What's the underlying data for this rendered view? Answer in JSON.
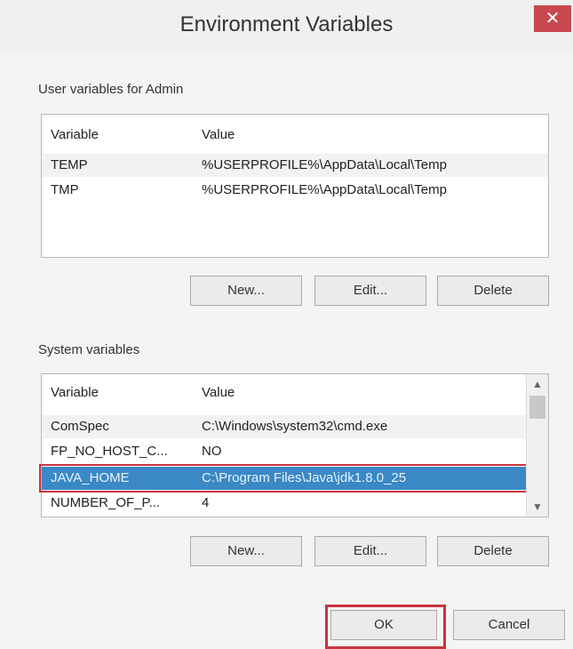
{
  "window": {
    "title": "Environment Variables",
    "close_icon": "close-icon"
  },
  "user_section": {
    "label": "User variables for Admin",
    "columns": [
      "Variable",
      "Value"
    ],
    "rows": [
      {
        "variable": "TEMP",
        "value": "%USERPROFILE%\\AppData\\Local\\Temp"
      },
      {
        "variable": "TMP",
        "value": "%USERPROFILE%\\AppData\\Local\\Temp"
      }
    ],
    "buttons": {
      "new": "New...",
      "edit": "Edit...",
      "delete": "Delete"
    }
  },
  "system_section": {
    "label": "System variables",
    "columns": [
      "Variable",
      "Value"
    ],
    "rows": [
      {
        "variable": "ComSpec",
        "value": "C:\\Windows\\system32\\cmd.exe"
      },
      {
        "variable": "FP_NO_HOST_C...",
        "value": "NO"
      },
      {
        "variable": "JAVA_HOME",
        "value": "C:\\Program Files\\Java\\jdk1.8.0_25"
      },
      {
        "variable": "NUMBER_OF_P...",
        "value": "4"
      }
    ],
    "selected_index": 2,
    "buttons": {
      "new": "New...",
      "edit": "Edit...",
      "delete": "Delete"
    }
  },
  "footer": {
    "ok": "OK",
    "cancel": "Cancel"
  },
  "colors": {
    "selection": "#3a88c4",
    "highlight_outline": "#c7343f",
    "close_button": "#c9484f"
  }
}
